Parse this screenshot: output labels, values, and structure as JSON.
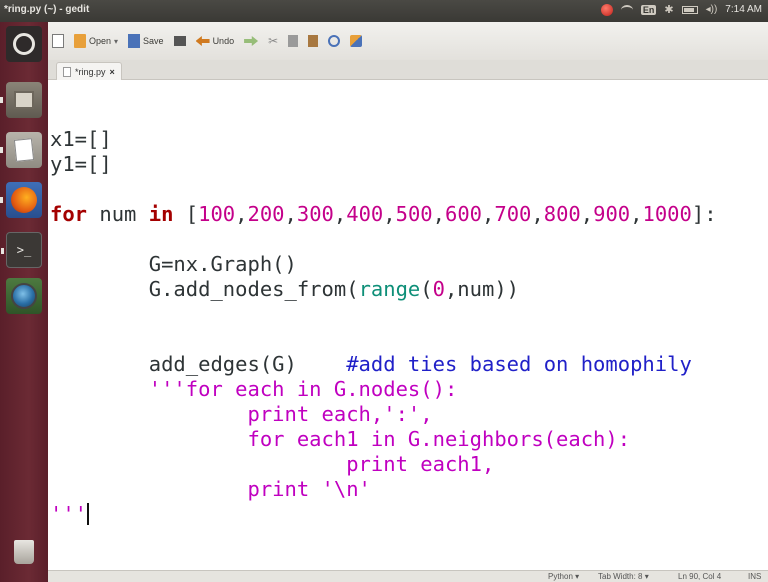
{
  "window_title": "*ring.py (~) - gedit",
  "tray": {
    "keyboard": "En",
    "bluetooth": "✱",
    "volume": "◂))",
    "clock": "7:14 AM"
  },
  "toolbar": {
    "open_label": "Open",
    "save_label": "Save",
    "undo_label": "Undo"
  },
  "tab": {
    "label": "*ring.py",
    "close": "×"
  },
  "code": {
    "x1": "x1=[]",
    "y1": "y1=[]",
    "for_kw": "for",
    "loop_var": " num ",
    "in_kw": "in",
    "list_open": " [",
    "list_values": [
      "100",
      "200",
      "300",
      "400",
      "500",
      "600",
      "700",
      "800",
      "900",
      "1000"
    ],
    "list_close": "]:",
    "graph_line": "        G=nx.Graph()",
    "add_nodes_pre": "        G.add_nodes_from(",
    "range_fn": "range",
    "range_paren": "(",
    "range_zero": "0",
    "add_nodes_post": ",num))",
    "add_edges": "        add_edges(G)    ",
    "add_edges_comment": "#add ties based on homophily",
    "doc1": "        '''for each in G.nodes():",
    "doc2": "                print each,':',",
    "doc3": "                for each1 in G.neighbors(each):",
    "doc4": "                        print each1,",
    "doc5": "                print '\\n'",
    "doc_end": "'''"
  },
  "status": {
    "language": "Python ▾",
    "tab_width": "Tab Width: 8 ▾",
    "position": "Ln 90, Col 4",
    "mode": "INS"
  }
}
